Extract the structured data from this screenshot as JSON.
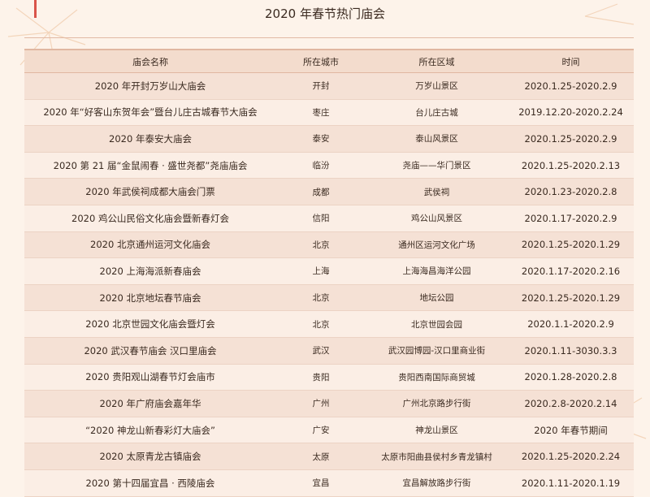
{
  "title": "2020 年春节热门庙会",
  "table": {
    "headers": [
      "庙会名称",
      "所在城市",
      "所在区域",
      "时间"
    ],
    "rows": [
      [
        "2020 年开封万岁山大庙会",
        "开封",
        "万岁山景区",
        "2020.1.25-2020.2.9"
      ],
      [
        "2020 年“好客山东贺年会”暨台儿庄古城春节大庙会",
        "枣庄",
        "台儿庄古城",
        "2019.12.20-2020.2.24"
      ],
      [
        "2020 年泰安大庙会",
        "泰安",
        "泰山风景区",
        "2020.1.25-2020.2.9"
      ],
      [
        "2020 第 21 届“金鼠闹春 · 盛世尧都”尧庙庙会",
        "临汾",
        "尧庙——华门景区",
        "2020.1.25-2020.2.13"
      ],
      [
        "2020 年武侯祠成都大庙会门票",
        "成都",
        "武侯祠",
        "2020.1.23-2020.2.8"
      ],
      [
        "2020 鸡公山民俗文化庙会暨新春灯会",
        "信阳",
        "鸡公山风景区",
        "2020.1.17-2020.2.9"
      ],
      [
        "2020 北京通州运河文化庙会",
        "北京",
        "通州区运河文化广场",
        "2020.1.25-2020.1.29"
      ],
      [
        "2020 上海海派新春庙会",
        "上海",
        "上海海昌海洋公园",
        "2020.1.17-2020.2.16"
      ],
      [
        "2020 北京地坛春节庙会",
        "北京",
        "地坛公园",
        "2020.1.25-2020.1.29"
      ],
      [
        "2020 北京世园文化庙会暨灯会",
        "北京",
        "北京世园会园",
        "2020.1.1-2020.2.9"
      ],
      [
        "2020 武汉春节庙会 汉口里庙会",
        "武汉",
        "武汉园博园-汉口里商业街",
        "2020.1.11-3030.3.3"
      ],
      [
        "2020 贵阳观山湖春节灯会庙市",
        "贵阳",
        "贵阳西南国际商贸城",
        "2020.1.28-2020.2.8"
      ],
      [
        "2020 年广府庙会嘉年华",
        "广州",
        "广州北京路步行街",
        "2020.2.8-2020.2.14"
      ],
      [
        "“2020 神龙山新春彩灯大庙会”",
        "广安",
        "神龙山景区",
        "2020 年春节期间"
      ],
      [
        "2020 太原青龙古镇庙会",
        "太原",
        "太原市阳曲县侯村乡青龙镇村",
        "2020.1.25-2020.2.24"
      ],
      [
        "2020 第十四届宜昌 · 西陵庙会",
        "宜昌",
        "宜昌解放路步行街",
        "2020.1.11-2020.1.19"
      ]
    ]
  }
}
